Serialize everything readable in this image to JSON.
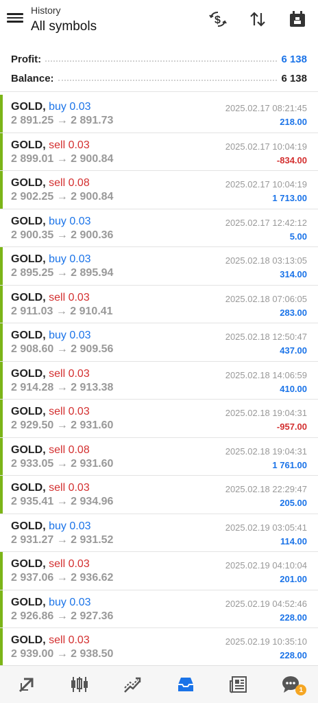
{
  "header": {
    "subtitle": "History",
    "title": "All symbols"
  },
  "summary": {
    "profit_label": "Profit:",
    "profit_value": "6 138",
    "balance_label": "Balance:",
    "balance_value": "6 138"
  },
  "deals": [
    {
      "symbol": "GOLD,",
      "side": "buy 0.03",
      "prices": "2 891.25 → 2 891.73",
      "time": "2025.02.17 08:21:45",
      "profit": "218.00",
      "bar": true
    },
    {
      "symbol": "GOLD,",
      "side": "sell 0.03",
      "prices": "2 899.01 → 2 900.84",
      "time": "2025.02.17 10:04:19",
      "profit": "-834.00",
      "bar": true
    },
    {
      "symbol": "GOLD,",
      "side": "sell 0.08",
      "prices": "2 902.25 → 2 900.84",
      "time": "2025.02.17 10:04:19",
      "profit": "1 713.00",
      "bar": true
    },
    {
      "symbol": "GOLD,",
      "side": "buy 0.03",
      "prices": "2 900.35 → 2 900.36",
      "time": "2025.02.17 12:42:12",
      "profit": "5.00",
      "bar": false
    },
    {
      "symbol": "GOLD,",
      "side": "buy 0.03",
      "prices": "2 895.25 → 2 895.94",
      "time": "2025.02.18 03:13:05",
      "profit": "314.00",
      "bar": true
    },
    {
      "symbol": "GOLD,",
      "side": "sell 0.03",
      "prices": "2 911.03 → 2 910.41",
      "time": "2025.02.18 07:06:05",
      "profit": "283.00",
      "bar": true
    },
    {
      "symbol": "GOLD,",
      "side": "buy 0.03",
      "prices": "2 908.60 → 2 909.56",
      "time": "2025.02.18 12:50:47",
      "profit": "437.00",
      "bar": true
    },
    {
      "symbol": "GOLD,",
      "side": "sell 0.03",
      "prices": "2 914.28 → 2 913.38",
      "time": "2025.02.18 14:06:59",
      "profit": "410.00",
      "bar": true
    },
    {
      "symbol": "GOLD,",
      "side": "sell 0.03",
      "prices": "2 929.50 → 2 931.60",
      "time": "2025.02.18 19:04:31",
      "profit": "-957.00",
      "bar": true
    },
    {
      "symbol": "GOLD,",
      "side": "sell 0.08",
      "prices": "2 933.05 → 2 931.60",
      "time": "2025.02.18 19:04:31",
      "profit": "1 761.00",
      "bar": true
    },
    {
      "symbol": "GOLD,",
      "side": "sell 0.03",
      "prices": "2 935.41 → 2 934.96",
      "time": "2025.02.18 22:29:47",
      "profit": "205.00",
      "bar": true
    },
    {
      "symbol": "GOLD,",
      "side": "buy 0.03",
      "prices": "2 931.27 → 2 931.52",
      "time": "2025.02.19 03:05:41",
      "profit": "114.00",
      "bar": false
    },
    {
      "symbol": "GOLD,",
      "side": "sell 0.03",
      "prices": "2 937.06 → 2 936.62",
      "time": "2025.02.19 04:10:04",
      "profit": "201.00",
      "bar": true
    },
    {
      "symbol": "GOLD,",
      "side": "buy 0.03",
      "prices": "2 926.86 → 2 927.36",
      "time": "2025.02.19 04:52:46",
      "profit": "228.00",
      "bar": true
    },
    {
      "symbol": "GOLD,",
      "side": "sell 0.03",
      "prices": "2 939.00 → 2 938.50",
      "time": "2025.02.19 10:35:10",
      "profit": "228.00",
      "bar": true
    }
  ],
  "colors": {
    "buy": "#1a73e8",
    "sell": "#d32f2f",
    "profit_pos": "#1a73e8",
    "profit_neg": "#d32f2f",
    "bar": "#7cb518",
    "active_nav": "#1a73e8"
  },
  "nav": {
    "items": [
      "quotes-icon",
      "chart-icon",
      "trade-icon",
      "history-icon",
      "news-icon",
      "messages-icon"
    ],
    "active": "history-icon",
    "badge": "1"
  }
}
